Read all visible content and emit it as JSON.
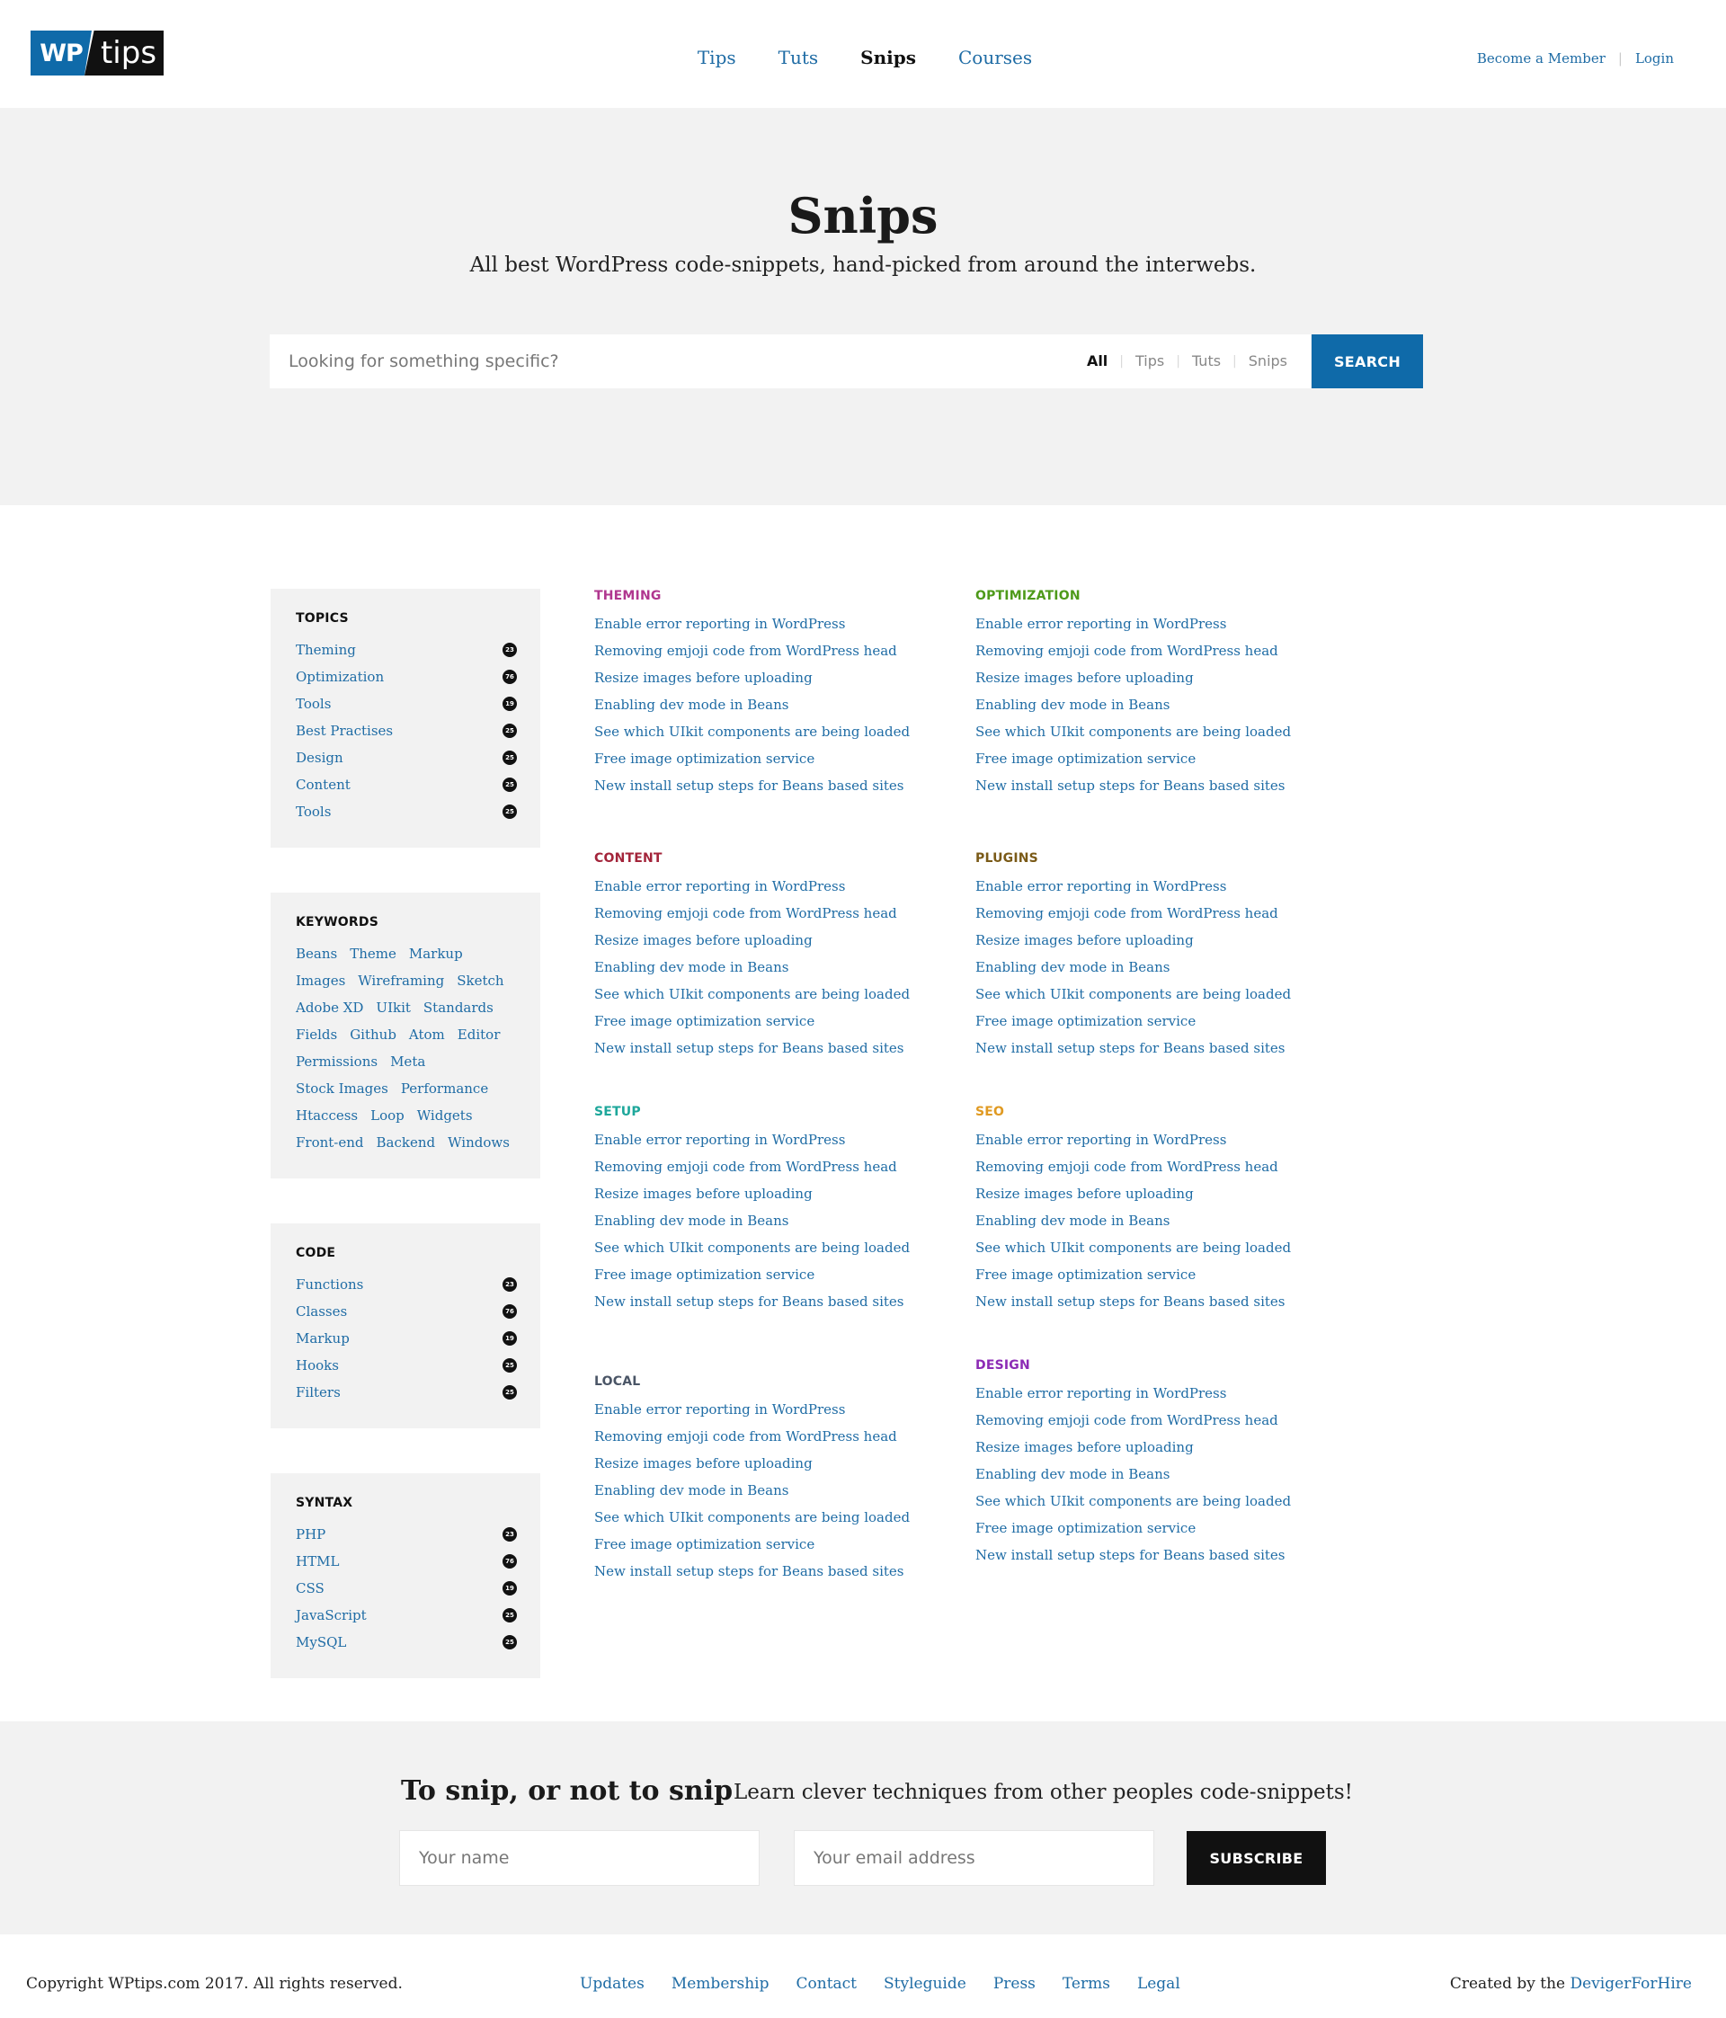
{
  "header": {
    "logo_wp": "WP",
    "logo_tips": "tips",
    "nav": [
      {
        "label": "Tips",
        "active": false
      },
      {
        "label": "Tuts",
        "active": false
      },
      {
        "label": "Snips",
        "active": true
      },
      {
        "label": "Courses",
        "active": false
      }
    ],
    "become_member": "Become a Member",
    "separator": "|",
    "login": "Login"
  },
  "hero": {
    "title": "Snips",
    "subtitle": "All best WordPress code-snippets, hand-picked from around the interwebs.",
    "search_placeholder": "Looking for something specific?",
    "filters": [
      "All",
      "Tips",
      "Tuts",
      "Snips"
    ],
    "filter_sep": "|",
    "search_button": "SEARCH"
  },
  "sidebar": {
    "topics": {
      "title": "TOPICS",
      "items": [
        {
          "label": "Theming",
          "count": "23"
        },
        {
          "label": "Optimization",
          "count": "76"
        },
        {
          "label": "Tools",
          "count": "19"
        },
        {
          "label": "Best Practises",
          "count": "25"
        },
        {
          "label": "Design",
          "count": "25"
        },
        {
          "label": "Content",
          "count": "25"
        },
        {
          "label": "Tools",
          "count": "25"
        }
      ]
    },
    "keywords": {
      "title": "KEYWORDS",
      "items": [
        "Beans",
        "Theme",
        "Markup",
        "Images",
        "Wireframing",
        "Sketch",
        "Adobe XD",
        "UIkit",
        "Standards",
        "Fields",
        "Github",
        "Atom",
        "Editor",
        "Permissions",
        "Meta",
        "Stock Images",
        "Performance",
        "Htaccess",
        "Loop",
        "Widgets",
        "Front-end",
        "Backend",
        "Windows"
      ]
    },
    "code": {
      "title": "CODE",
      "items": [
        {
          "label": "Functions",
          "count": "23"
        },
        {
          "label": "Classes",
          "count": "76"
        },
        {
          "label": "Markup",
          "count": "19"
        },
        {
          "label": "Hooks",
          "count": "25"
        },
        {
          "label": "Filters",
          "count": "25"
        }
      ]
    },
    "syntax": {
      "title": "SYNTAX",
      "items": [
        {
          "label": "PHP",
          "count": "23"
        },
        {
          "label": "HTML",
          "count": "76"
        },
        {
          "label": "CSS",
          "count": "19"
        },
        {
          "label": "JavaScript",
          "count": "25"
        },
        {
          "label": "MySQL",
          "count": "25"
        }
      ]
    }
  },
  "snippet_titles": [
    "Enable error reporting in WordPress",
    "Removing emjoji code from WordPress head",
    "Resize images before uploading",
    "Enabling dev mode in Beans",
    "See which UIkit components are being loaded",
    "Free image optimization service",
    "New install setup steps for Beans based sites"
  ],
  "categories": {
    "theming": {
      "title": "THEMING",
      "color": "#b0378f"
    },
    "optimization": {
      "title": "OPTIMIZATION",
      "color": "#4e9a1a"
    },
    "content": {
      "title": "CONTENT",
      "color": "#a3243a"
    },
    "plugins": {
      "title": "PLUGINS",
      "color": "#7a5a17"
    },
    "setup": {
      "title": "SETUP",
      "color": "#1ea79b"
    },
    "seo": {
      "title": "SEO",
      "color": "#e09a22"
    },
    "local": {
      "title": "LOCAL",
      "color": "#4a5566"
    },
    "design": {
      "title": "DESIGN",
      "color": "#8c2bb5"
    }
  },
  "newsletter": {
    "title": "To snip, or not to snip",
    "subtitle": "Learn clever techniques from other peoples code-snippets!",
    "name_placeholder": "Your name",
    "email_placeholder": "Your email address",
    "button": "SUBSCRIBE"
  },
  "footer": {
    "copyright": "Copyright WPtips.com 2017. All rights reserved.",
    "links": [
      "Updates",
      "Membership",
      "Contact",
      "Styleguide",
      "Press",
      "Terms",
      "Legal"
    ],
    "credit_prefix": "Created by the ",
    "credit_link": "DevigerForHire"
  }
}
